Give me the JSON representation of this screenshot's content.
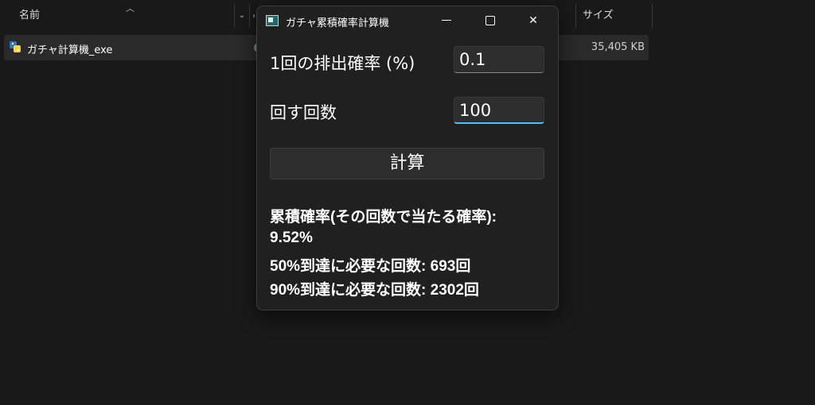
{
  "explorer": {
    "columns": {
      "name": "名前",
      "size": "サイズ"
    },
    "file": {
      "name": "ガチャ計算機_exe",
      "size": "35,405 KB"
    }
  },
  "window": {
    "title": "ガチャ累積確率計算機",
    "icon": "app-window-icon"
  },
  "form": {
    "rate_label": "1回の排出確率 (%)",
    "rate_value": "0.1",
    "count_label": "回す回数",
    "count_value": "100",
    "calc_button": "計算"
  },
  "results": {
    "line1": "累積確率(その回数で当たる確率):",
    "line2": "9.52%",
    "line3": "50%到達に必要な回数: 693回",
    "line4": "90%到達に必要な回数: 2302回"
  },
  "colors": {
    "background": "#191919",
    "window": "#202020",
    "focus_accent": "#4cc2ff"
  }
}
